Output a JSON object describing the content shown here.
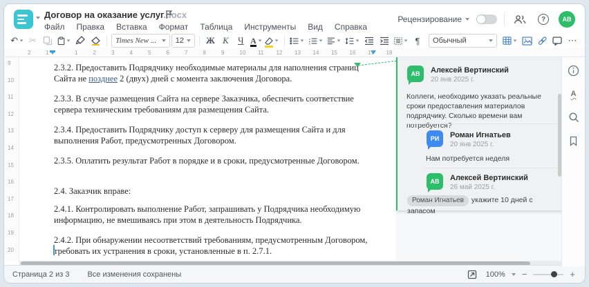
{
  "window": {
    "title": "Договор на оказание услуг",
    "title_ext": ".docx"
  },
  "icons": {
    "undo": "↶",
    "cut": "✂",
    "help": "?",
    "more": "⋯",
    "minus": "−",
    "plus": "+",
    "spellcheck_letter": "А"
  },
  "menu": {
    "items": [
      "Файл",
      "Правка",
      "Вставка",
      "Формат",
      "Таблица",
      "Инструменты",
      "Вид",
      "Справка"
    ]
  },
  "header": {
    "review_label": "Рецензирование",
    "avatar_initials": "АВ"
  },
  "toolbar": {
    "font_name": "Times New ...",
    "font_size": "12",
    "bold": "Ж",
    "italic": "К",
    "underline": "Ч",
    "font_color": "А",
    "pilcrow": "¶",
    "style_name": "Обычный"
  },
  "ruler": {
    "h": [
      "2",
      "1",
      "1",
      "2",
      "3",
      "4",
      "5",
      "6",
      "7",
      "8",
      "9",
      "10",
      "11",
      "12",
      "13",
      "14",
      "15",
      "16",
      "17",
      "18"
    ],
    "v": [
      "9",
      "10",
      "11",
      "12",
      "13",
      "14",
      "15",
      "16",
      "17",
      "18",
      "19",
      "20"
    ]
  },
  "document": {
    "p1_before": "2.3.2. Предоставить Подрядчику необходимые материалы для наполнения страниц Сайта не ",
    "p1_marked": "позднее",
    "p1_after": " 2 (двух) дней с момента заключения Договора.",
    "paragraphs": [
      "2.3.3. В случае размещения Сайта на сервере Заказчика, обеспечить соответствие сервера техническим требованиям для размещения Сайта.",
      "2.3.4. Предоставить Подрядчику доступ к серверу для размещения Сайта и для выполнения Работ, предусмотренных Договором.",
      "2.3.5. Оплатить результат Работ в порядке и в сроки, предусмотренные Договором.",
      "2.4. Заказчик вправе:",
      "2.4.1. Контролировать выполнение Работ, запрашивать у Подрядчика необходимую информацию, не вмешиваясь при этом в деятельность Подрядчика.",
      "2.4.2. При обнаружении несоответствий требованиям, предусмотренным Договором, требовать их устранения в сроки, установленные в п. 2.7.1."
    ]
  },
  "comments": {
    "thread": [
      {
        "initials": "АВ",
        "name": "Алексей Вертинский",
        "date": "20 янв 2025 г.",
        "color": "#2ebd6b",
        "text": "Коллеги, необходимо указать реальные сроки предоставления материалов подрядчику. Сколько времени вам потребуется?"
      },
      {
        "initials": "РИ",
        "name": "Роман Игнатьев",
        "date": "20 янв 2025 г.",
        "color": "#3d8bf2",
        "text": "Нам потребуется неделя"
      },
      {
        "initials": "АВ",
        "name": "Алексей Вертинский",
        "date": "26 май 2025 г.",
        "color": "#2ebd6b",
        "mention": "Роман Игнатьев",
        "text": "укажите 10 дней с запасом"
      }
    ]
  },
  "status_bar": {
    "page_info": "Страница 2 из 3",
    "saved_status": "Все изменения сохранены",
    "zoom_level": "100%"
  }
}
